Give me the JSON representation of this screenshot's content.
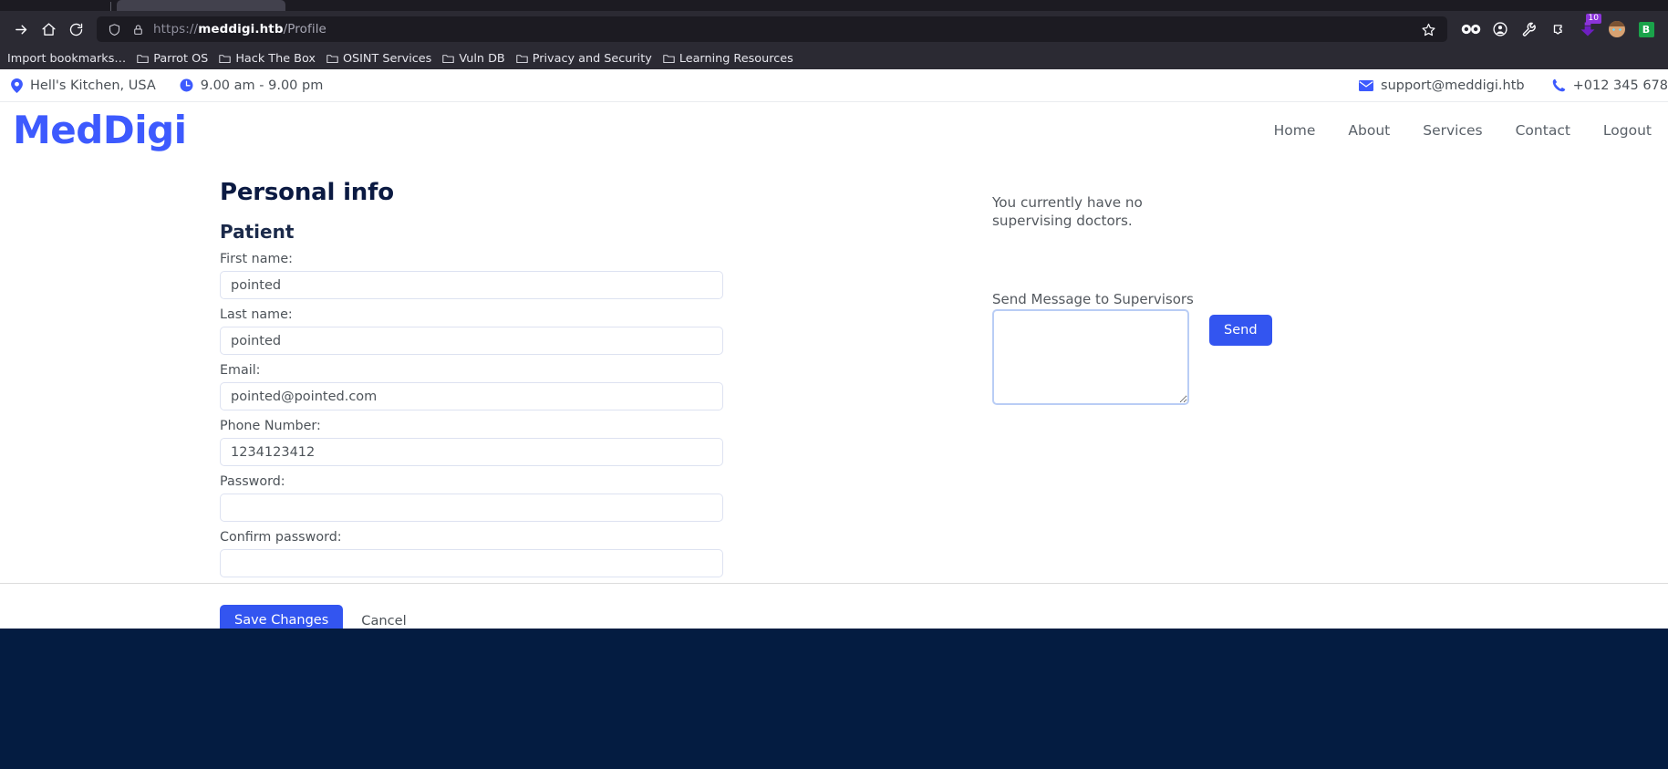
{
  "browser": {
    "url_prefix": "https://",
    "url_host": "meddigi.htb",
    "url_path": "/Profile",
    "nav_icons": {
      "forward": "forward-arrow-icon",
      "home": "home-icon",
      "reload": "reload-icon",
      "shield": "shield-icon",
      "lock": "padlock-icon",
      "star": "bookmark-star-icon"
    },
    "toolbar_extensions": [
      {
        "name": "infinity-icon",
        "label": ""
      },
      {
        "name": "account-circle-icon",
        "label": ""
      },
      {
        "name": "wrench-icon",
        "label": ""
      },
      {
        "name": "puzzle-extension-icon",
        "label": ""
      },
      {
        "name": "downloads-icon",
        "badge": "10"
      },
      {
        "name": "profile-avatar-icon",
        "label": ""
      },
      {
        "name": "bitwarden-icon",
        "label": "B"
      }
    ],
    "bookmarks": [
      {
        "label": "Import bookmarks…",
        "has_folder": false
      },
      {
        "label": "Parrot OS",
        "has_folder": true
      },
      {
        "label": "Hack The Box",
        "has_folder": true
      },
      {
        "label": "OSINT Services",
        "has_folder": true
      },
      {
        "label": "Vuln DB",
        "has_folder": true
      },
      {
        "label": "Privacy and Security",
        "has_folder": true
      },
      {
        "label": "Learning Resources",
        "has_folder": true
      }
    ]
  },
  "site": {
    "topbar": {
      "location": "Hell's Kitchen, USA",
      "hours": "9.00 am - 9.00 pm",
      "email": "support@meddigi.htb",
      "phone": "+012 345 678"
    },
    "brand": "MedDigi",
    "nav": [
      {
        "label": "Home"
      },
      {
        "label": "About"
      },
      {
        "label": "Services"
      },
      {
        "label": "Contact"
      },
      {
        "label": "Logout"
      }
    ],
    "accent_color": "#3d5afe",
    "button_color": "#3355f0",
    "footer_color": "#041c41",
    "heading_color": "#0b1a42"
  },
  "profile": {
    "page_title": "Personal info",
    "role": "Patient",
    "fields": [
      {
        "label": "First name:",
        "value": "pointed",
        "type": "text",
        "name": "first-name-input"
      },
      {
        "label": "Last name:",
        "value": "pointed",
        "type": "text",
        "name": "last-name-input"
      },
      {
        "label": "Email:",
        "value": "pointed@pointed.com",
        "type": "text",
        "name": "email-input"
      },
      {
        "label": "Phone Number:",
        "value": "1234123412",
        "type": "text",
        "name": "phone-number-input"
      },
      {
        "label": "Password:",
        "value": "",
        "type": "password",
        "name": "password-input"
      },
      {
        "label": "Confirm password:",
        "value": "",
        "type": "password",
        "name": "confirm-password-input"
      }
    ],
    "save_label": "Save Changes",
    "cancel_label": "Cancel"
  },
  "supervisors": {
    "empty_message": "You currently have no supervising doctors.",
    "send_label": "Send Message to Supervisors",
    "message_value": "",
    "send_button_label": "Send"
  }
}
